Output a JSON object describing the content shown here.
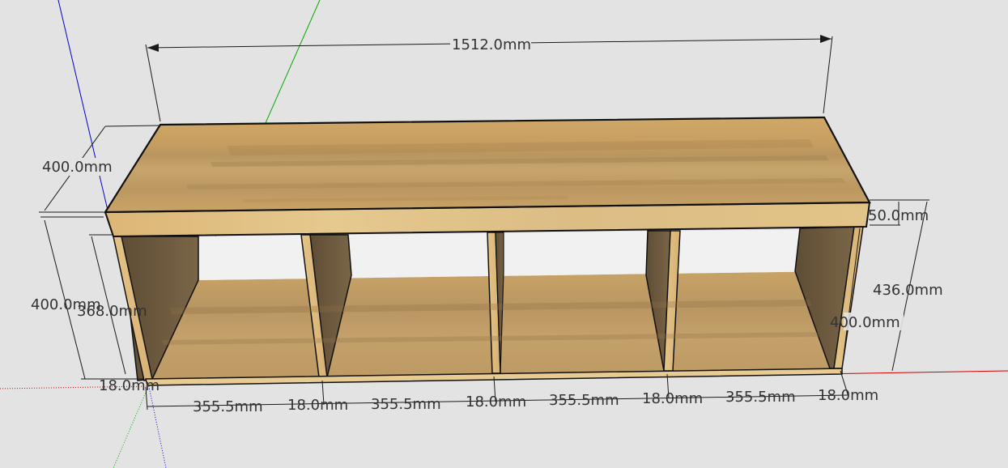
{
  "colors": {
    "background": "#e3e3e3",
    "x_axis": "#cc0000",
    "y_axis": "#00aa00",
    "z_axis": "#0000cc",
    "wood_light": "#d8b878",
    "wood_mid": "#c19a5c",
    "wood_dark_side": "#6e5a3e",
    "edge": "#111111",
    "dimension_text": "#333333"
  },
  "dimensions": {
    "overall_length": "1512.0mm",
    "top_depth": "400.0mm",
    "top_thickness": "50.0mm",
    "overall_height": "436.0mm",
    "carcass_height": "400.0mm",
    "inner_height": "368.0mm",
    "right_side_height": "400.0mm",
    "bottom_thickness": "18.0mm",
    "bays": [
      {
        "width": "355.5mm",
        "divider": "18.0mm"
      },
      {
        "width": "355.5mm",
        "divider": "18.0mm"
      },
      {
        "width": "355.5mm",
        "divider": "18.0mm"
      },
      {
        "width": "355.5mm",
        "divider": "18.0mm"
      }
    ]
  }
}
